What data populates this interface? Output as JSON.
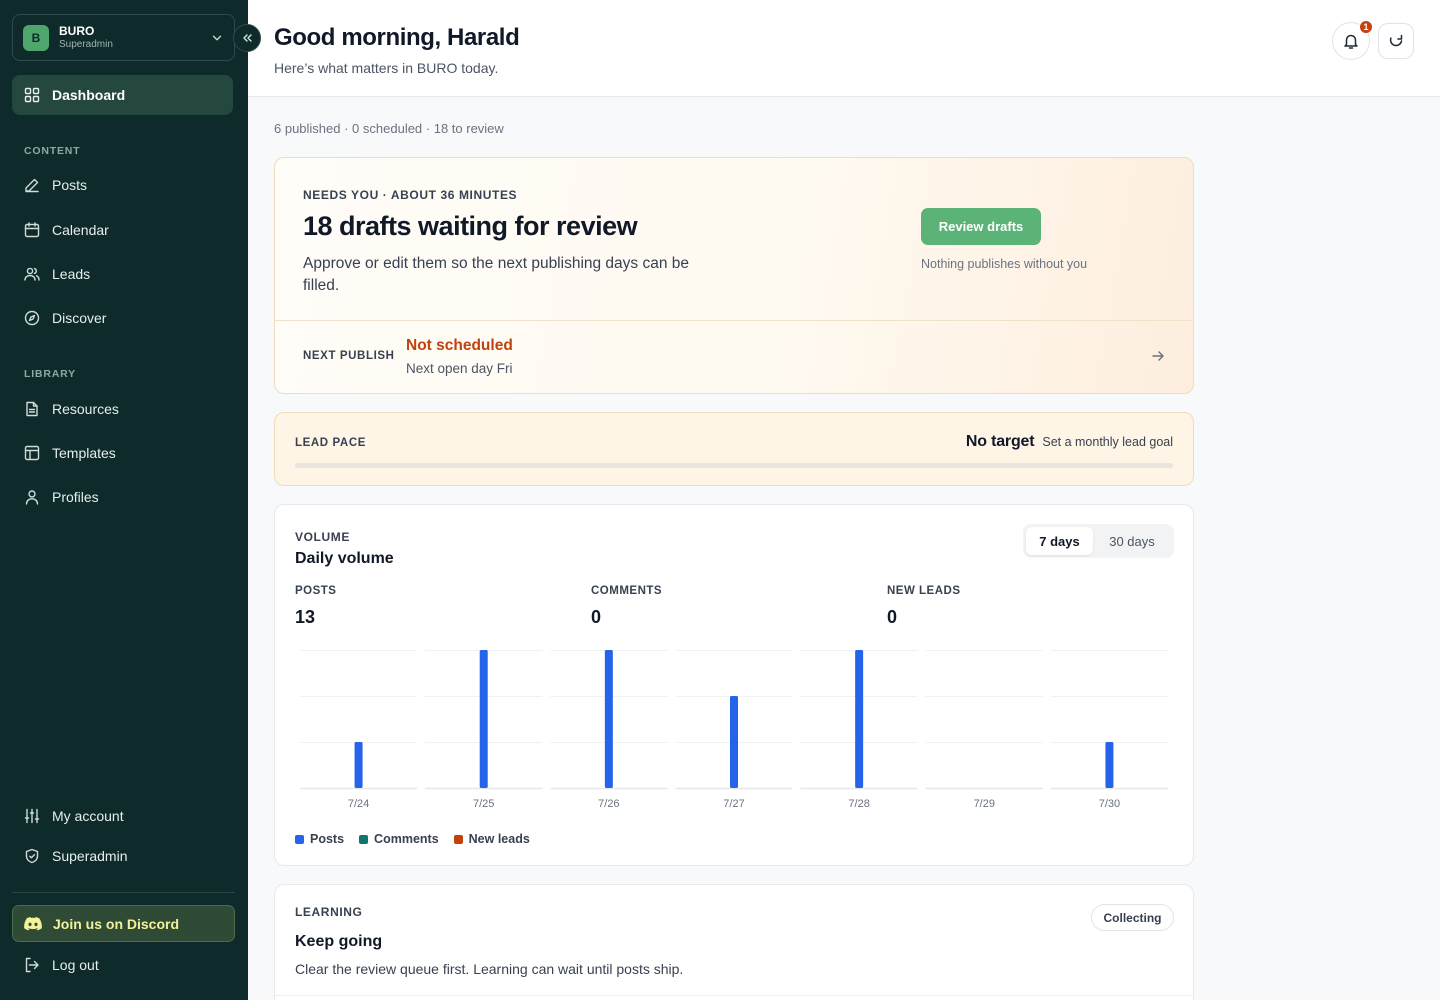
{
  "workspace": {
    "initial": "B",
    "name": "BURO",
    "role": "Superadmin"
  },
  "sidebar": {
    "items": [
      {
        "label": "Dashboard",
        "icon": "grid-icon"
      },
      {
        "label": "Posts",
        "icon": "pencil-icon"
      },
      {
        "label": "Calendar",
        "icon": "calendar-icon"
      },
      {
        "label": "Leads",
        "icon": "users-icon"
      },
      {
        "label": "Discover",
        "icon": "compass-icon"
      },
      {
        "label": "Resources",
        "icon": "document-icon"
      },
      {
        "label": "Templates",
        "icon": "layout-icon"
      },
      {
        "label": "Profiles",
        "icon": "user-icon"
      }
    ],
    "sections": {
      "content": "CONTENT",
      "library": "LIBRARY"
    },
    "bottom": [
      {
        "label": "My account",
        "icon": "sliders-icon"
      },
      {
        "label": "Superadmin",
        "icon": "shield-icon"
      }
    ],
    "discord_label": "Join us on Discord",
    "logout_label": "Log out"
  },
  "header": {
    "greeting": "Good morning, Harald",
    "subtitle": "Here’s what matters in BURO today.",
    "notification_count": "1"
  },
  "summary": "6 published · 0 scheduled · 18 to review",
  "hero": {
    "eyebrow": "NEEDS YOU · ABOUT 36 MINUTES",
    "title": "18 drafts waiting for review",
    "description": "Approve or edit them so the next publishing days can be filled.",
    "button": "Review drafts",
    "note": "Nothing publishes without you",
    "next_publish_label": "NEXT PUBLISH",
    "next_publish_status": "Not scheduled",
    "next_publish_sub": "Next open day Fri"
  },
  "lead_pace": {
    "label": "LEAD PACE",
    "value": "No target",
    "hint": "Set a monthly lead goal",
    "progress": 0
  },
  "volume": {
    "eyebrow": "VOLUME",
    "title": "Daily volume",
    "range_options": [
      "7 days",
      "30 days"
    ],
    "selected_range": "7 days",
    "stats": [
      {
        "label": "POSTS",
        "value": "13"
      },
      {
        "label": "COMMENTS",
        "value": "0"
      },
      {
        "label": "NEW LEADS",
        "value": "0"
      }
    ]
  },
  "chart_data": {
    "type": "bar",
    "categories": [
      "7/24",
      "7/25",
      "7/26",
      "7/27",
      "7/28",
      "7/29",
      "7/30"
    ],
    "series": [
      {
        "name": "Posts",
        "color": "#2563eb",
        "values": [
          1,
          3,
          3,
          2,
          3,
          0,
          1
        ]
      },
      {
        "name": "Comments",
        "color": "#0f766e",
        "values": [
          0,
          0,
          0,
          0,
          0,
          0,
          0
        ]
      },
      {
        "name": "New leads",
        "color": "#c2410c",
        "values": [
          0,
          0,
          0,
          0,
          0,
          0,
          0
        ]
      }
    ],
    "ylim": [
      0,
      3
    ],
    "grid": true,
    "legend": "bottom-left"
  },
  "learning": {
    "eyebrow": "LEARNING",
    "badge": "Collecting",
    "title": "Keep going",
    "description": "Clear the review queue first. Learning can wait until posts ship."
  },
  "colors": {
    "sidebar_bg": "#0e2a2a",
    "accent_green": "#5cb377",
    "warning": "#c2410c",
    "bar_blue": "#2563eb"
  }
}
